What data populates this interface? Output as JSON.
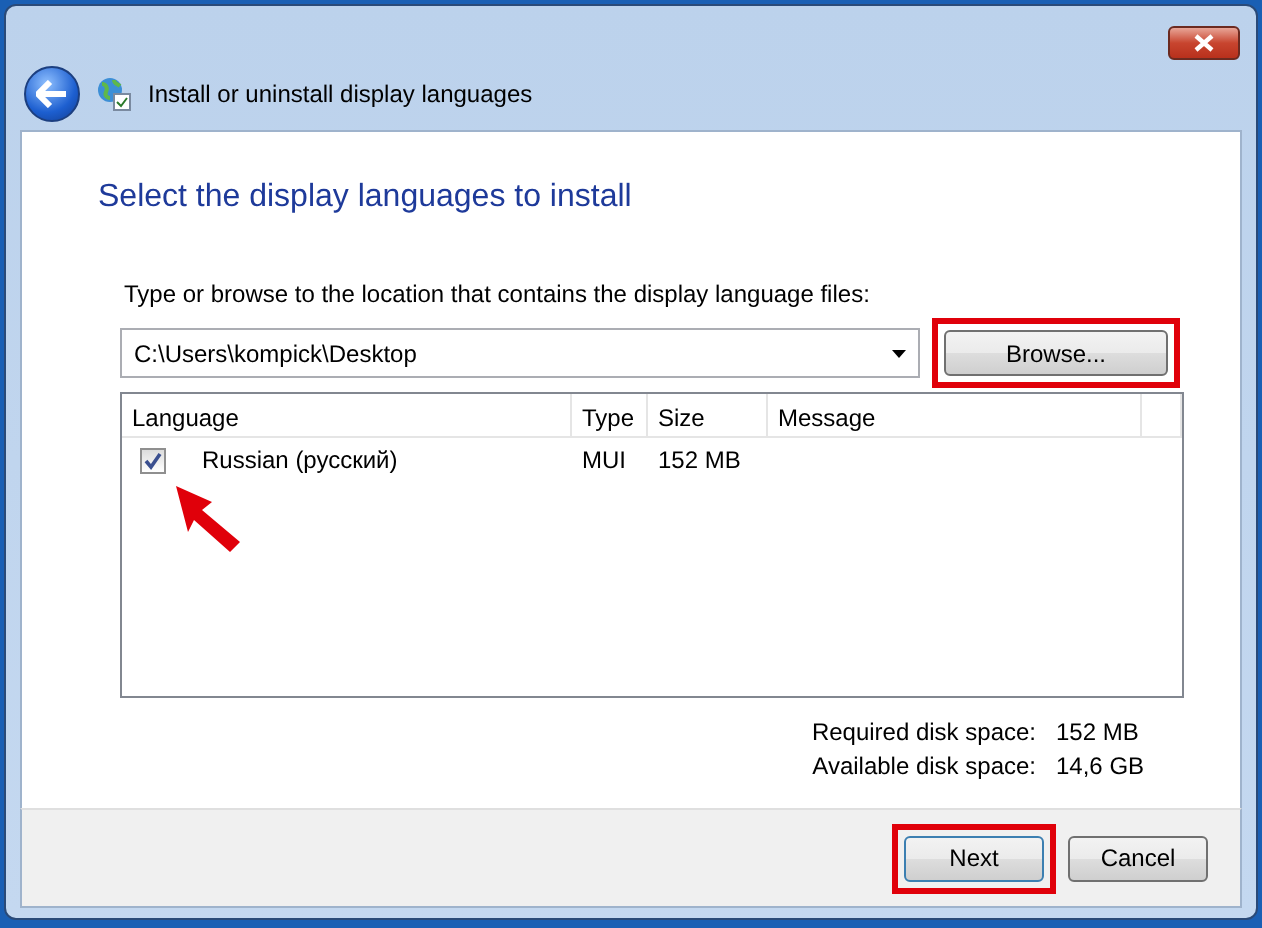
{
  "window": {
    "title": "Install or uninstall display languages"
  },
  "heading": "Select the display languages to install",
  "location": {
    "label": "Type or browse to the location that contains the display language files:",
    "value": "C:\\Users\\kompick\\Desktop"
  },
  "browse_button": {
    "label": "Browse...",
    "highlighted": true
  },
  "table": {
    "columns": [
      "Language",
      "Type",
      "Size",
      "Message"
    ],
    "rows": [
      {
        "language": "Russian (русский)",
        "type": "MUI",
        "size": "152 MB",
        "checked": true
      }
    ]
  },
  "disk_space": [
    {
      "label": "Required disk space:",
      "value": "152 MB"
    },
    {
      "label": "Available disk space:",
      "value": "14,6 GB"
    }
  ],
  "buttons": [
    {
      "label": "Next",
      "highlighted": true
    },
    {
      "label": "Cancel",
      "highlighted": false
    }
  ]
}
